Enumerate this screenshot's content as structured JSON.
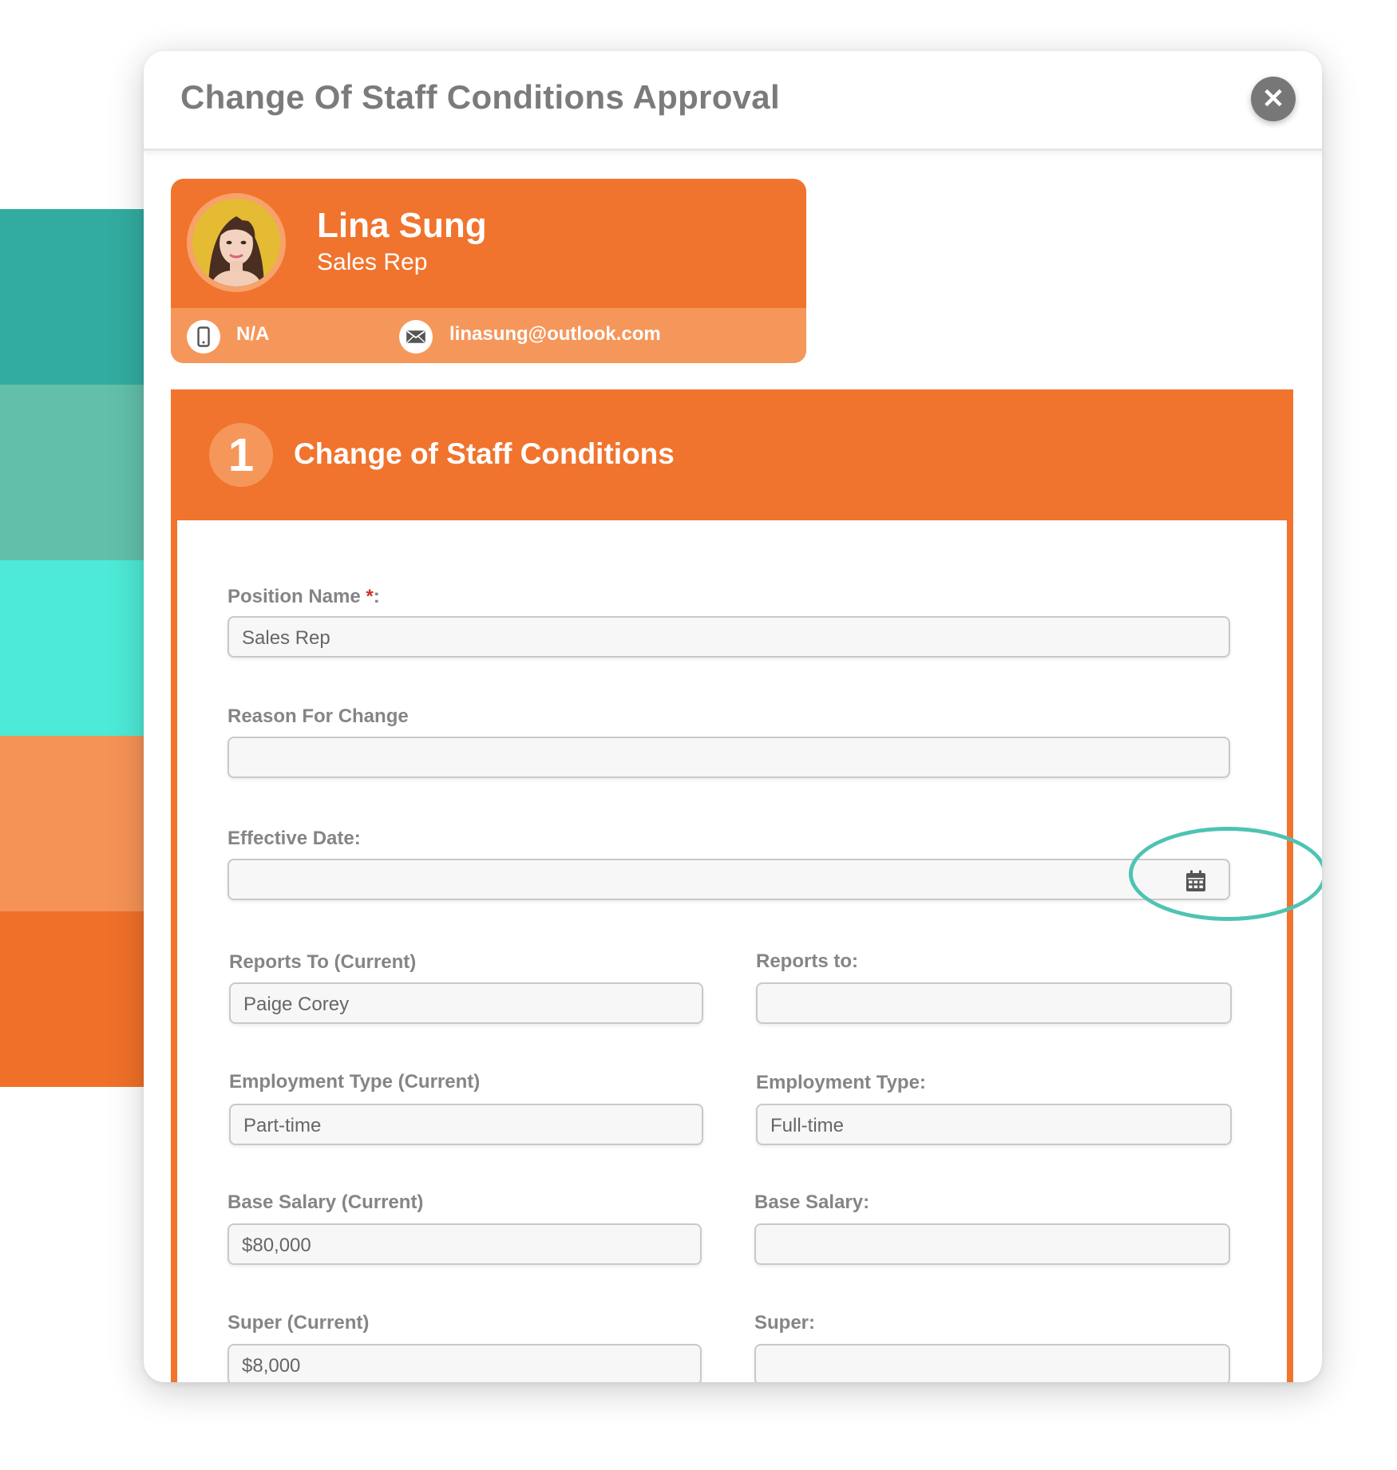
{
  "colors": {
    "accent_orange": "#f0742e",
    "accent_orange_light": "#f5975a",
    "teal_ring": "#4ec3b3",
    "stripes": [
      "#32aca0",
      "#62c0aa",
      "#4dead7",
      "#f59357",
      "#f07028"
    ]
  },
  "modal": {
    "title": "Change Of Staff Conditions Approval",
    "close_icon": "close-icon"
  },
  "profile": {
    "name": "Lina Sung",
    "role": "Sales Rep",
    "phone": "N/A",
    "email": "linasung@outlook.com",
    "phone_icon": "mobile-phone-icon",
    "email_icon": "envelope-icon"
  },
  "section": {
    "number": "1",
    "title": "Change of Staff Conditions"
  },
  "form": {
    "position_name": {
      "label": "Position Name",
      "required_mark": "*",
      "colon": ":",
      "value": "Sales Rep"
    },
    "reason_for_change": {
      "label": "Reason For Change",
      "value": ""
    },
    "effective_date": {
      "label": "Effective Date:",
      "value": "",
      "icon": "calendar-icon"
    },
    "reports_to_current": {
      "label": "Reports To (Current)",
      "value": "Paige Corey"
    },
    "reports_to": {
      "label": "Reports to:",
      "value": ""
    },
    "employment_type_current": {
      "label": "Employment Type (Current)",
      "value": "Part-time"
    },
    "employment_type": {
      "label": "Employment Type:",
      "value": "Full-time"
    },
    "base_salary_current": {
      "label": "Base Salary (Current)",
      "value": "$80,000"
    },
    "base_salary": {
      "label": "Base Salary:",
      "value": ""
    },
    "super_current": {
      "label": "Super (Current)",
      "value": "$8,000"
    },
    "super": {
      "label": "Super:",
      "value": ""
    }
  }
}
